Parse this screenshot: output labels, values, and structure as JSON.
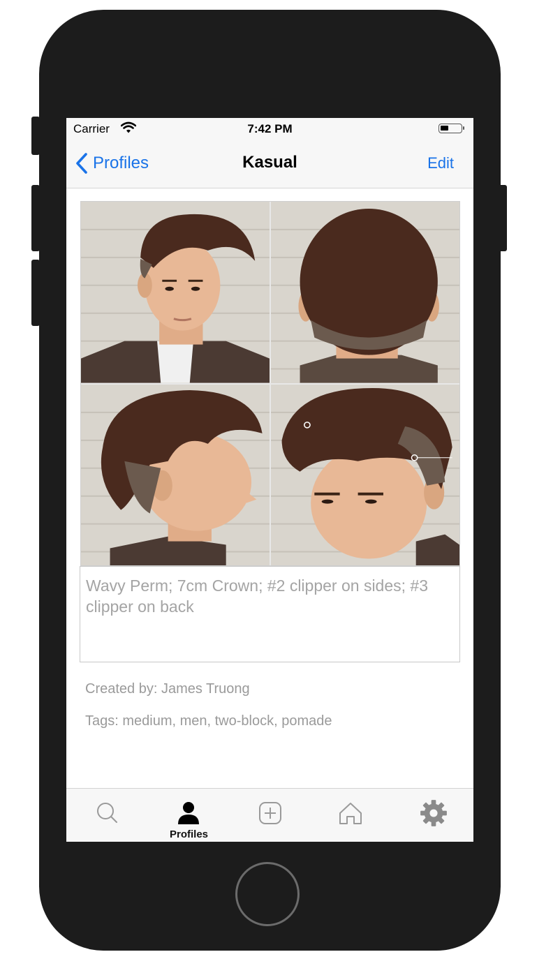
{
  "status_bar": {
    "carrier": "Carrier",
    "time": "7:42 PM"
  },
  "nav": {
    "back_label": "Profiles",
    "title": "Kasual",
    "edit_label": "Edit"
  },
  "notes": {
    "text": "Wavy Perm; 7cm Crown; #2 clipper on sides; #3 clipper on back"
  },
  "created_by": "Created by: James Truong",
  "tags": "Tags: medium, men, two-block, pomade",
  "tab_bar": {
    "active_label": "Profiles",
    "items": [
      {
        "icon": "search-icon"
      },
      {
        "icon": "person-icon",
        "label": "Profiles",
        "active": true
      },
      {
        "icon": "add-icon"
      },
      {
        "icon": "home-icon"
      },
      {
        "icon": "gear-icon"
      }
    ]
  },
  "colors": {
    "accent": "#1a73e8",
    "device": "#1c1c1c",
    "hair": "#4a2a1e",
    "skin": "#e8b896",
    "brick": "#d8d4cc"
  },
  "photos": [
    "hairstyle-front-view",
    "hairstyle-back-view",
    "hairstyle-side-view",
    "hairstyle-angled-view"
  ]
}
